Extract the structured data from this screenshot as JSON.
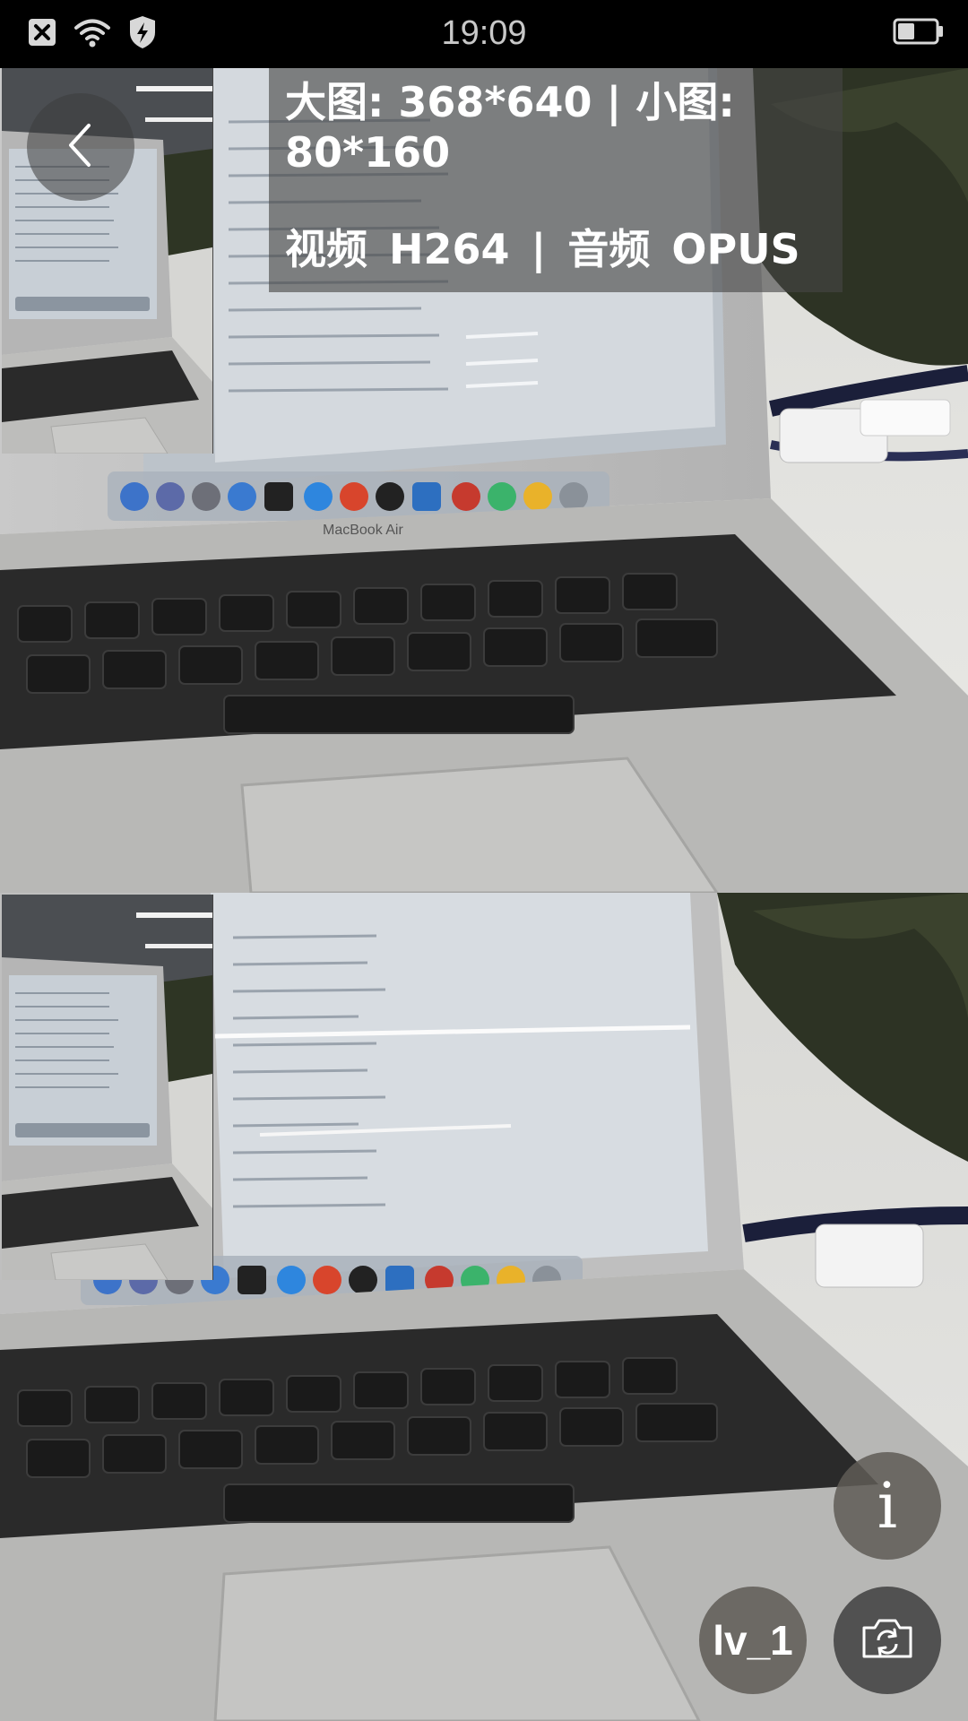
{
  "status_bar": {
    "time": "19:09",
    "icons": [
      "close-box-icon",
      "wifi-icon",
      "shield-bolt-icon",
      "battery-icon"
    ]
  },
  "info": {
    "resolution_text": "大图: 368*640  |  小图: 80*160",
    "codec_text": "视频  H264  |  音频  OPUS"
  },
  "controls": {
    "info_label": "i",
    "level_label": "lv_1"
  },
  "screen_labels": {
    "laptop_model": "MacBook Air"
  }
}
